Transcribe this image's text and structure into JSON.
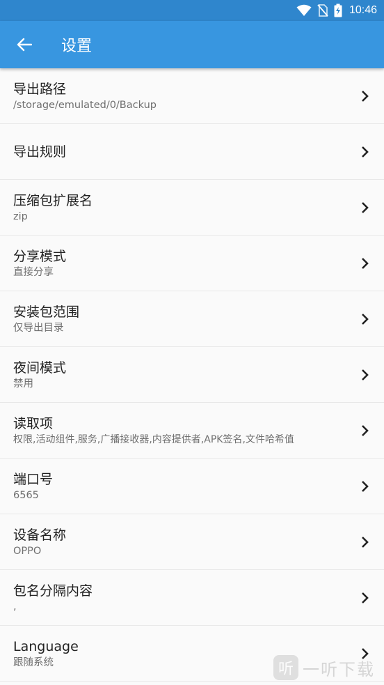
{
  "status_bar": {
    "time": "10:46"
  },
  "app_bar": {
    "title": "设置"
  },
  "items": [
    {
      "title": "导出路径",
      "subtitle": "/storage/emulated/0/Backup"
    },
    {
      "title": "导出规则",
      "subtitle": ""
    },
    {
      "title": "压缩包扩展名",
      "subtitle": "zip"
    },
    {
      "title": "分享模式",
      "subtitle": "直接分享"
    },
    {
      "title": "安装包范围",
      "subtitle": "仅导出目录"
    },
    {
      "title": "夜间模式",
      "subtitle": "禁用"
    },
    {
      "title": "读取项",
      "subtitle": "权限,活动组件,服务,广播接收器,内容提供者,APK签名,文件哈希值"
    },
    {
      "title": "端口号",
      "subtitle": "6565"
    },
    {
      "title": "设备名称",
      "subtitle": "OPPO"
    },
    {
      "title": "包名分隔内容",
      "subtitle": ","
    },
    {
      "title": "Language",
      "subtitle": "跟随系统"
    }
  ],
  "watermark": {
    "logo": "听",
    "text": "一听下载"
  },
  "colors": {
    "status_bar": "#2f86cd",
    "app_bar": "#3896e0",
    "background": "#fafafa"
  }
}
